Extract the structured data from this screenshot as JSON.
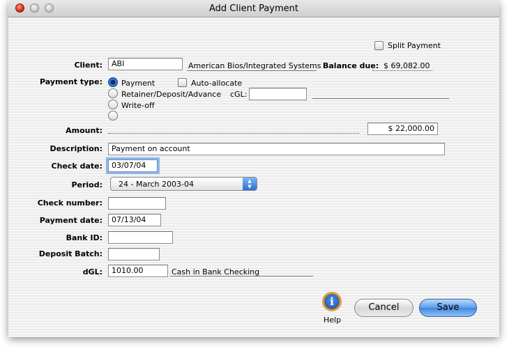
{
  "window": {
    "title": "Add Client Payment"
  },
  "split_payment": {
    "label": "Split Payment"
  },
  "client": {
    "label": "Client:",
    "code": "ABI",
    "name": "American Bios/Integrated Systems",
    "balance_label": "Balance due:",
    "balance_value": "$ 69,082.00"
  },
  "payment_type": {
    "label": "Payment type:",
    "options": [
      "Payment",
      "Retainer/Deposit/Advance",
      "Write-off",
      ""
    ],
    "selected": "Payment",
    "auto_allocate_label": "Auto-allocate",
    "cgl_label": "cGL:",
    "cgl_value": ""
  },
  "amount": {
    "label": "Amount:",
    "value": "$ 22,000.00"
  },
  "description": {
    "label": "Description:",
    "value": "Payment on account"
  },
  "check_date": {
    "label": "Check date:",
    "value": "03/07/04"
  },
  "period": {
    "label": "Period:",
    "value": "24 - March 2003-04"
  },
  "check_number": {
    "label": "Check number:",
    "value": ""
  },
  "payment_date": {
    "label": "Payment date:",
    "value": "07/13/04"
  },
  "bank_id": {
    "label": "Bank ID:",
    "value": ""
  },
  "deposit_batch": {
    "label": "Deposit Batch:",
    "value": ""
  },
  "dgl": {
    "label": "dGL:",
    "value": "1010.00",
    "account_name": "Cash in Bank Checking"
  },
  "buttons": {
    "help": "Help",
    "cancel": "Cancel",
    "save": "Save"
  },
  "icons": {
    "help": "info-icon"
  }
}
